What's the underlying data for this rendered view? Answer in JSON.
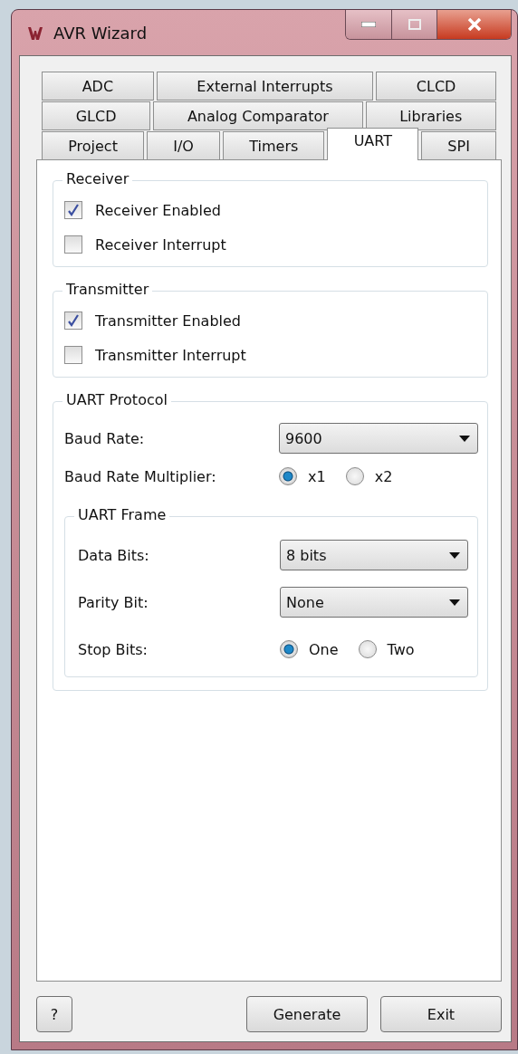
{
  "window": {
    "title": "AVR Wizard"
  },
  "tab_rows": [
    [
      {
        "label": "ADC",
        "selected": false
      },
      {
        "label": "External Interrupts",
        "selected": false
      },
      {
        "label": "CLCD",
        "selected": false
      }
    ],
    [
      {
        "label": "GLCD",
        "selected": false
      },
      {
        "label": "Analog Comparator",
        "selected": false
      },
      {
        "label": "Libraries",
        "selected": false
      }
    ],
    [
      {
        "label": "Project",
        "selected": false
      },
      {
        "label": "I/O",
        "selected": false
      },
      {
        "label": "Timers",
        "selected": false
      },
      {
        "label": "UART",
        "selected": true
      },
      {
        "label": "SPI",
        "selected": false
      }
    ]
  ],
  "receiver": {
    "title": "Receiver",
    "options": [
      {
        "label": "Receiver Enabled",
        "checked": true
      },
      {
        "label": "Receiver Interrupt",
        "checked": false
      }
    ]
  },
  "transmitter": {
    "title": "Transmitter",
    "options": [
      {
        "label": "Transmitter Enabled",
        "checked": true
      },
      {
        "label": "Transmitter Interrupt",
        "checked": false
      }
    ]
  },
  "uart_protocol": {
    "title": "UART Protocol",
    "rows": [
      {
        "kind": "dropdown",
        "label": "Baud Rate:",
        "value": "9600"
      },
      {
        "kind": "radio",
        "label": "Baud Rate Multiplier:",
        "options": [
          {
            "label": "x1",
            "selected": true
          },
          {
            "label": "x2",
            "selected": false
          }
        ]
      }
    ],
    "uart_frame": {
      "title": "UART Frame",
      "rows": [
        {
          "kind": "dropdown",
          "label": "Data Bits:",
          "value": "8 bits"
        },
        {
          "kind": "dropdown",
          "label": "Parity Bit:",
          "value": "None"
        },
        {
          "kind": "radio",
          "label": "Stop Bits:",
          "options": [
            {
              "label": "One",
              "selected": true
            },
            {
              "label": "Two",
              "selected": false
            }
          ]
        }
      ]
    }
  },
  "buttons": {
    "help": "?",
    "generate": "Generate",
    "exit": "Exit"
  }
}
